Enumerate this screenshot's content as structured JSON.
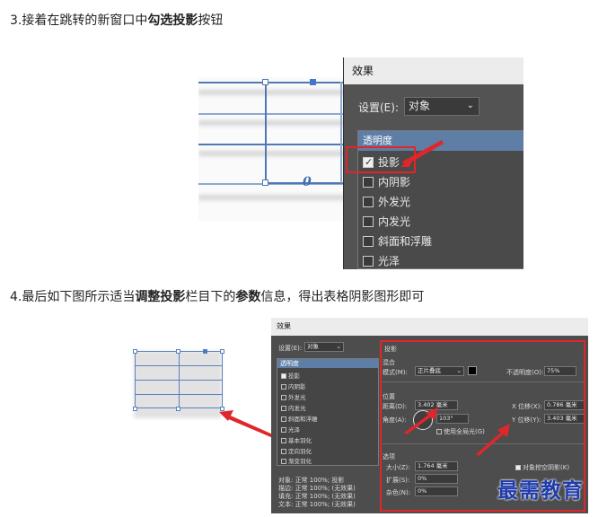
{
  "steps": [
    {
      "prefix": "3.接着在跳转的新窗口中",
      "bold": "勾选投影",
      "suffix": "按钮"
    },
    {
      "prefix": "4.最后如下图所示适当",
      "bold1": "调整投影",
      "mid": "栏目下的",
      "bold2": "参数",
      "suffix": "信息，得出表格阴影图形即可"
    }
  ],
  "dialog1": {
    "title": "效果",
    "setting_label": "设置(E):",
    "setting_value": "对象",
    "list_header": "透明度",
    "items": [
      {
        "label": "投影",
        "checked": true
      },
      {
        "label": "内阴影",
        "checked": false
      },
      {
        "label": "外发光",
        "checked": false
      },
      {
        "label": "内发光",
        "checked": false
      },
      {
        "label": "斜面和浮雕",
        "checked": false
      },
      {
        "label": "光泽",
        "checked": false
      }
    ],
    "table_glyph": "0"
  },
  "dialog2": {
    "title": "效果",
    "setting_label": "设置(E):",
    "setting_value": "对象",
    "list_header": "透明度",
    "items": [
      {
        "label": "投影",
        "checked": true
      },
      {
        "label": "内阴影",
        "checked": false
      },
      {
        "label": "外发光",
        "checked": false
      },
      {
        "label": "内发光",
        "checked": false
      },
      {
        "label": "斜面和浮雕",
        "checked": false
      },
      {
        "label": "光泽",
        "checked": false
      },
      {
        "label": "基本羽化",
        "checked": false
      },
      {
        "label": "定向羽化",
        "checked": false
      },
      {
        "label": "渐变羽化",
        "checked": false
      }
    ],
    "summary": [
      "对象: 正常 100%; 投影",
      "描边: 正常 100%; (无效果)",
      "填充: 正常 100%; (无效果)",
      "文本: 正常 100%; (无效果)"
    ],
    "section_title": "投影",
    "blend": {
      "title": "混合",
      "mode_label": "模式(M):",
      "mode_value": "正片叠底",
      "opacity_label": "不透明度(O):",
      "opacity_value": "75%"
    },
    "position": {
      "title": "位置",
      "distance_label": "距离(D):",
      "distance_value": "3.402 毫米",
      "angle_label": "角度(A):",
      "angle_value": "103°",
      "global_light_label": "使用全局光(G)",
      "x_label": "X 位移(X):",
      "x_value": "0.786 毫米",
      "y_label": "Y 位移(Y):",
      "y_value": "3.403 毫米"
    },
    "options": {
      "title": "选项",
      "size_label": "大小(Z):",
      "size_value": "1.764 毫米",
      "spread_label": "扩展(S):",
      "spread_value": "0%",
      "noise_label": "杂色(N):",
      "noise_value": "0%",
      "knockout_label": "对象挖空阴影(K)"
    }
  },
  "watermark": "最需教育",
  "colors": {
    "highlight": "#e0262a",
    "dialog_bg": "#535353",
    "list_header": "#5e7ea5",
    "table_line": "#4f79b5",
    "watermark": "#1f3cab"
  }
}
